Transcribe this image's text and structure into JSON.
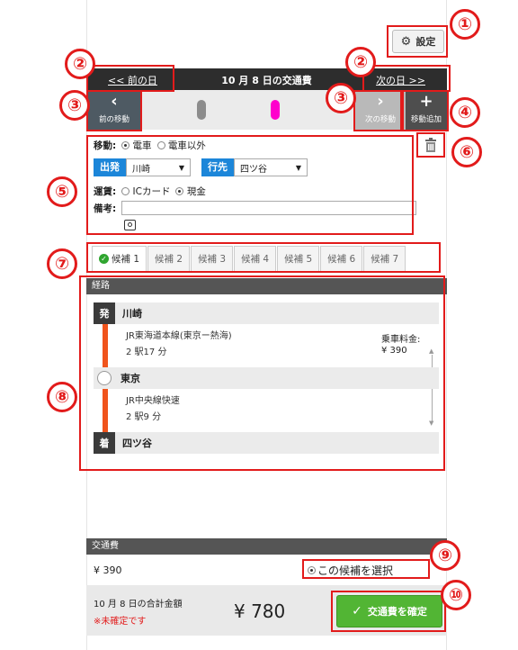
{
  "toolbar": {
    "settings_label": "設定",
    "settings_icon": "gear-icon"
  },
  "date_nav": {
    "prev_label": "<< 前の日",
    "title": "10 月 8 日の交通費",
    "next_label": "次の日 >>"
  },
  "move_bar": {
    "prev_label": "前の移動",
    "next_label": "次の移動",
    "add_label": "移動追加",
    "markers": [
      "#8c8c8c",
      "#ff00cc"
    ]
  },
  "form": {
    "transport_label": "移動:",
    "transport_options": [
      "電車",
      "電車以外"
    ],
    "transport_selected": "電車",
    "from_label": "出発",
    "from_value": "川崎",
    "to_label": "行先",
    "to_value": "四ツ谷",
    "fare_label": "運賃:",
    "fare_options": [
      "ICカード",
      "現金"
    ],
    "fare_selected": "現金",
    "note_label": "備考:",
    "note_value": ""
  },
  "tabs": [
    "候補 1",
    "候補 2",
    "候補 3",
    "候補 4",
    "候補 5",
    "候補 6",
    "候補 7"
  ],
  "route": {
    "section_title": "経路",
    "start_badge": "発",
    "start_station": "川崎",
    "leg1_line": "JR東海道本線(東京ー熱海)",
    "leg1_detail": "2 駅17 分",
    "fare_label": "乗車料金:",
    "fare_value": "¥ 390",
    "transfer_station": "東京",
    "leg2_line": "JR中央線快速",
    "leg2_detail": "2 駅9 分",
    "end_badge": "着",
    "end_station": "四ツ谷"
  },
  "cost": {
    "section_title": "交通費",
    "amount": "¥ 390",
    "select_label": "この候補を選択",
    "total_label": "10 月 8 日の合計金額",
    "unconfirmed": "※未確定です",
    "total_amount": "¥ 780",
    "confirm_label": "交通費を確定"
  },
  "callouts": [
    "①",
    "②",
    "②",
    "③",
    "③",
    "④",
    "⑤",
    "⑥",
    "⑦",
    "⑧",
    "⑨",
    "⑩"
  ],
  "colors": {
    "accent_blue": "#1c86d9",
    "route_orange": "#f0541c",
    "confirm_green": "#52b534",
    "callout_red": "#e21b1b"
  }
}
